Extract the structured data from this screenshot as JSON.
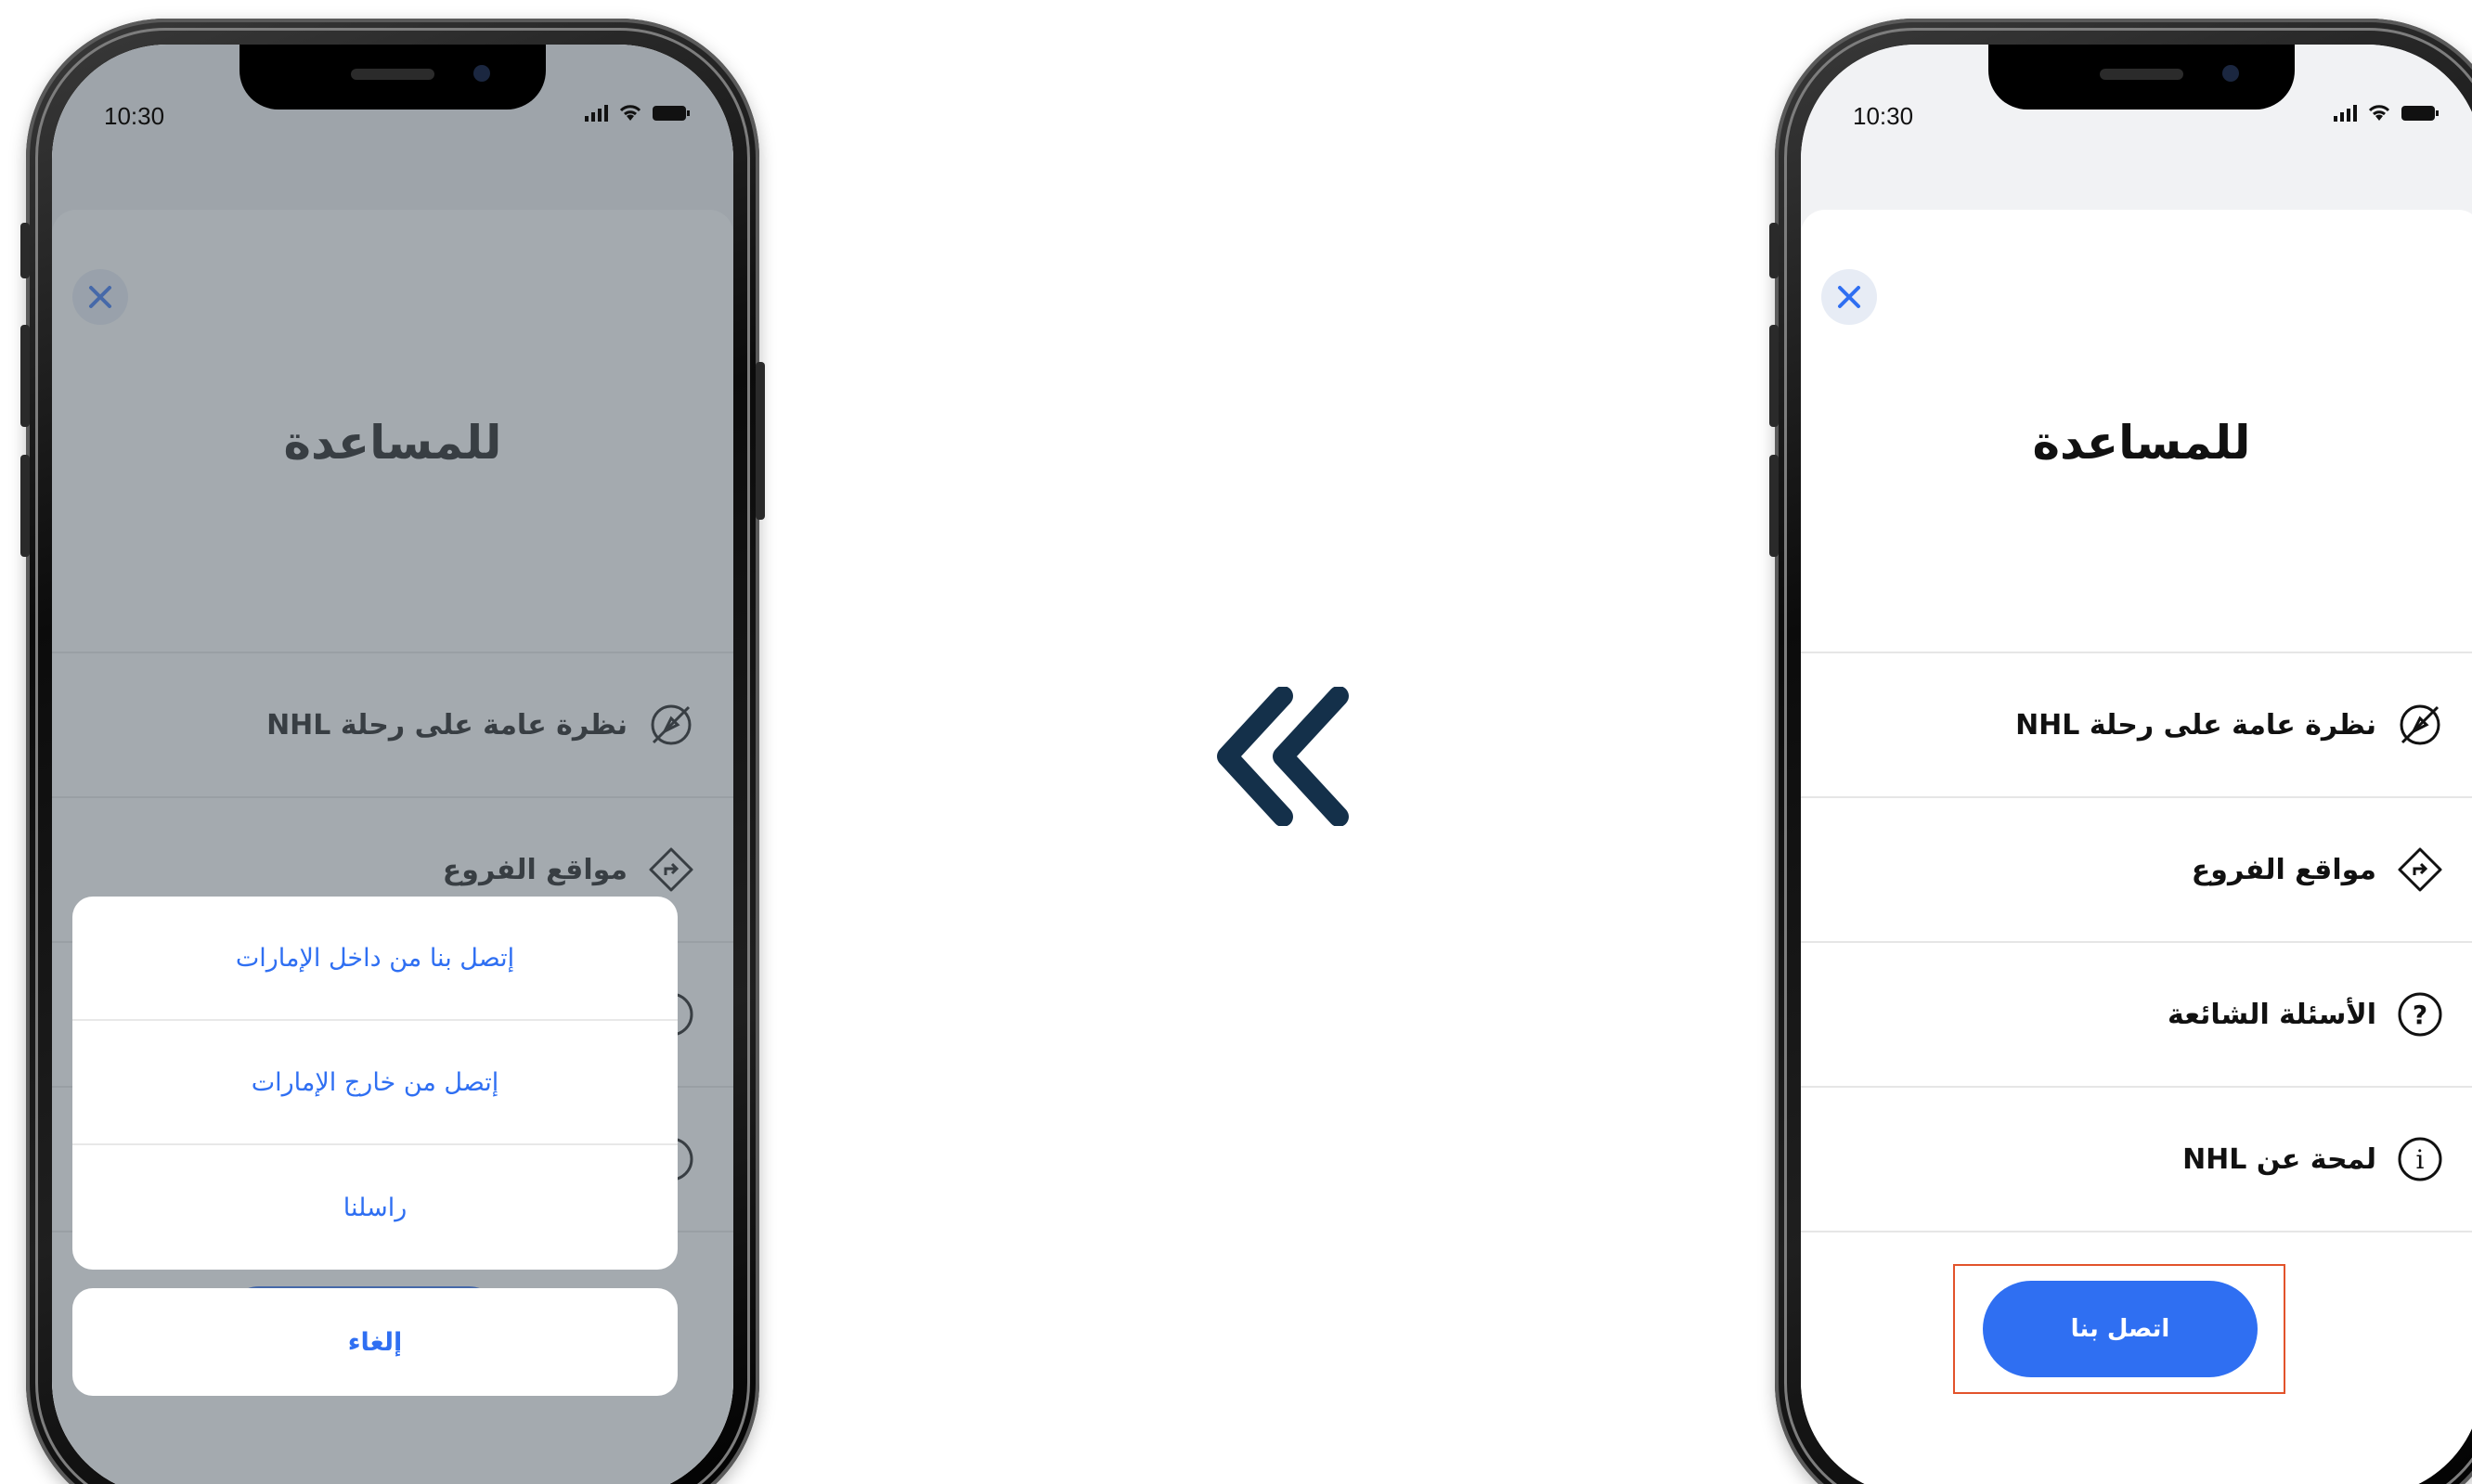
{
  "status_time": "10:30",
  "colors": {
    "accent": "#2f6ff2",
    "highlight_border": "#e2532b",
    "arrow": "#14304a"
  },
  "screen_title": "للمساعدة",
  "menu": [
    {
      "label": "نظرة عامة على رحلة NHL",
      "icon": "compass-off-icon"
    },
    {
      "label": "مواقع الفروع",
      "icon": "direction-sign-icon"
    },
    {
      "label": "الأسئلة الشائعة",
      "icon": "question-circle-icon"
    },
    {
      "label": "لمحة عن NHL",
      "icon": "info-circle-icon"
    }
  ],
  "contact_button": "اتصل بنا",
  "action_sheet": {
    "options": [
      "إتصل بنا من داخل الإمارات",
      "إتصل من خارج الإمارات",
      "راسلنا"
    ],
    "cancel": "إلغاء"
  }
}
